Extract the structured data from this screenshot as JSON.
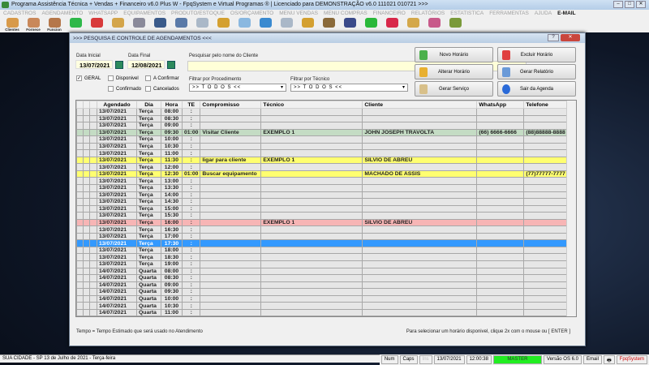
{
  "app": {
    "title": "Programa Assistência Técnica + Vendas + Financeiro v6.0 Plus W - FpqSystem e Virtual Programas ® | Licenciado para  DEMONSTRAÇÃO v6.0 111021 010721 >>>"
  },
  "menu": [
    "CADASTROS",
    "AGENDAMENTO",
    "WHATSAPP",
    "EQUIPAMENTOS",
    "PRODUTO/ESTOQUE",
    "OS/ORÇAMENTO",
    "MENU VENDAS",
    "MENU COMPRAS",
    "FINANCEIRO",
    "RELATÓRIOS",
    "ESTATISTICA",
    "FERRAMENTAS",
    "AJUDA"
  ],
  "menu_email": "E-MAIL",
  "toolbar": [
    {
      "label": "Clientes",
      "color": "#d89a4a"
    },
    {
      "label": "Fornece",
      "color": "#c9885a"
    },
    {
      "label": "Funcion",
      "color": "#b5774a"
    },
    {
      "label": "",
      "color": "#2fb84a"
    },
    {
      "label": "",
      "color": "#d83a3a"
    },
    {
      "label": "",
      "color": "#d4a54a"
    },
    {
      "label": "",
      "color": "#8a8a9a"
    },
    {
      "label": "",
      "color": "#3a5a8a"
    },
    {
      "label": "",
      "color": "#5a7aa8"
    },
    {
      "label": "",
      "color": "#aab8c8"
    },
    {
      "label": "",
      "color": "#d4a030"
    },
    {
      "label": "",
      "color": "#8ab8e0"
    },
    {
      "label": "",
      "color": "#3a8ad0"
    },
    {
      "label": "",
      "color": "#aab8c8"
    },
    {
      "label": "",
      "color": "#d4a030"
    },
    {
      "label": "",
      "color": "#8a6a3a"
    },
    {
      "label": "",
      "color": "#3a4a8a"
    },
    {
      "label": "",
      "color": "#2ab83a"
    },
    {
      "label": "",
      "color": "#d8284a"
    },
    {
      "label": "",
      "color": "#d4a84a"
    },
    {
      "label": "",
      "color": "#c85a8a"
    },
    {
      "label": "",
      "color": "#7a9a3a"
    }
  ],
  "dialog": {
    "title": ">>>  PESQUISA E CONTROLE DE AGENDAMENTOS  <<<",
    "data_inicial_label": "Data Inicial",
    "data_inicial": "13/07/2021",
    "data_final_label": "Data Final",
    "data_final": "12/08/2021",
    "search_label": "Pesquisar pelo nome do Cliente",
    "search_value": "",
    "checks": {
      "geral": "GERAL",
      "disponivel": "Disponivel",
      "a_confirmar": "A Confirmar",
      "confirmado": "Confirmado",
      "cancelados": "Cancelados"
    },
    "filtro_proc_label": "Filtrar por Procedimento",
    "filtro_proc": ">> T O D O S <<",
    "filtro_tec_label": "Filtrar por Técnico",
    "filtro_tec": ">> T O D O S <<",
    "buttons": {
      "novo": "Novo Horário",
      "excluir": "Excluir Horário",
      "alterar": "Alterar Horário",
      "relatorio": "Gerar Relatório",
      "servico": "Gerar  Serviço",
      "sair": "Sair da Agenda"
    },
    "columns": [
      "Agendado",
      "Dia",
      "Hora",
      "TE",
      "Compromisso",
      "Técnico",
      "Cliente",
      "WhatsApp",
      "Telefone"
    ],
    "rows": [
      [
        "13/07/2021",
        "Terça",
        "08:00",
        ":",
        "",
        "",
        "",
        "",
        ""
      ],
      [
        "13/07/2021",
        "Terça",
        "08:30",
        ":",
        "",
        "",
        "",
        "",
        ""
      ],
      [
        "13/07/2021",
        "Terça",
        "09:00",
        ":",
        "",
        "",
        "",
        "",
        ""
      ],
      [
        "13/07/2021",
        "Terça",
        "09:30",
        "01:00",
        "Visitar Cliente",
        "EXEMPLO 1",
        "JOHN JOSEPH TRAVOLTA",
        "(66) 6666-6666",
        "(88)88888-8888",
        "green"
      ],
      [
        "13/07/2021",
        "Terça",
        "10:00",
        ":",
        "",
        "",
        "",
        "",
        ""
      ],
      [
        "13/07/2021",
        "Terça",
        "10:30",
        ":",
        "",
        "",
        "",
        "",
        ""
      ],
      [
        "13/07/2021",
        "Terça",
        "11:00",
        ":",
        "",
        "",
        "",
        "",
        ""
      ],
      [
        "13/07/2021",
        "Terça",
        "11:30",
        ":",
        "ligar para cliente",
        "EXEMPLO 1",
        "SILVIO DE ABREU",
        "",
        "",
        "yellow"
      ],
      [
        "13/07/2021",
        "Terça",
        "12:00",
        ":",
        "",
        "",
        "",
        "",
        ""
      ],
      [
        "13/07/2021",
        "Terça",
        "12:30",
        "01:00",
        "Buscar equipamento",
        "",
        "MACHADO DE ASSIS",
        "",
        "(77)77777-7777",
        "yellow"
      ],
      [
        "13/07/2021",
        "Terça",
        "13:00",
        ":",
        "",
        "",
        "",
        "",
        ""
      ],
      [
        "13/07/2021",
        "Terça",
        "13:30",
        ":",
        "",
        "",
        "",
        "",
        ""
      ],
      [
        "13/07/2021",
        "Terça",
        "14:00",
        ":",
        "",
        "",
        "",
        "",
        ""
      ],
      [
        "13/07/2021",
        "Terça",
        "14:30",
        ":",
        "",
        "",
        "",
        "",
        ""
      ],
      [
        "13/07/2021",
        "Terça",
        "15:00",
        ":",
        "",
        "",
        "",
        "",
        ""
      ],
      [
        "13/07/2021",
        "Terça",
        "15:30",
        ":",
        "",
        "",
        "",
        "",
        ""
      ],
      [
        "13/07/2021",
        "Terça",
        "16:00",
        ":",
        "",
        "EXEMPLO 1",
        "SILVIO DE ABREU",
        "",
        "",
        "pink"
      ],
      [
        "13/07/2021",
        "Terça",
        "16:30",
        ":",
        "",
        "",
        "",
        "",
        ""
      ],
      [
        "13/07/2021",
        "Terça",
        "17:00",
        ":",
        "",
        "",
        "",
        "",
        ""
      ],
      [
        "13/07/2021",
        "Terça",
        "17:30",
        ":",
        "",
        "",
        "",
        "",
        "",
        "blue"
      ],
      [
        "13/07/2021",
        "Terça",
        "18:00",
        ":",
        "",
        "",
        "",
        "",
        ""
      ],
      [
        "13/07/2021",
        "Terça",
        "18:30",
        ":",
        "",
        "",
        "",
        "",
        ""
      ],
      [
        "13/07/2021",
        "Terça",
        "19:00",
        ":",
        "",
        "",
        "",
        "",
        ""
      ],
      [
        "14/07/2021",
        "Quarta",
        "08:00",
        ":",
        "",
        "",
        "",
        "",
        ""
      ],
      [
        "14/07/2021",
        "Quarta",
        "08:30",
        ":",
        "",
        "",
        "",
        "",
        ""
      ],
      [
        "14/07/2021",
        "Quarta",
        "09:00",
        ":",
        "",
        "",
        "",
        "",
        ""
      ],
      [
        "14/07/2021",
        "Quarta",
        "09:30",
        ":",
        "",
        "",
        "",
        "",
        ""
      ],
      [
        "14/07/2021",
        "Quarta",
        "10:00",
        ":",
        "",
        "",
        "",
        "",
        ""
      ],
      [
        "14/07/2021",
        "Quarta",
        "10:30",
        ":",
        "",
        "",
        "",
        "",
        ""
      ],
      [
        "14/07/2021",
        "Quarta",
        "11:00",
        ":",
        "",
        "",
        "",
        "",
        ""
      ]
    ],
    "footer_left": "Tempo = Tempo Estimado que será usado no Atendimento",
    "footer_right": "Para selecionar um horário disponivel, clique 2x com o mouse ou [ ENTER ]"
  },
  "statusbar": {
    "city": "SUA CIDADE - SP 13 de Julho de 2021 - Terça-feira",
    "num": "Num",
    "caps": "Caps",
    "ins": "Ins",
    "date": "13/07/2021",
    "time": "12:00:38",
    "user": "MASTER",
    "version": "Versão OS 6.0",
    "email": "Email",
    "brand": "FpqSystem"
  }
}
